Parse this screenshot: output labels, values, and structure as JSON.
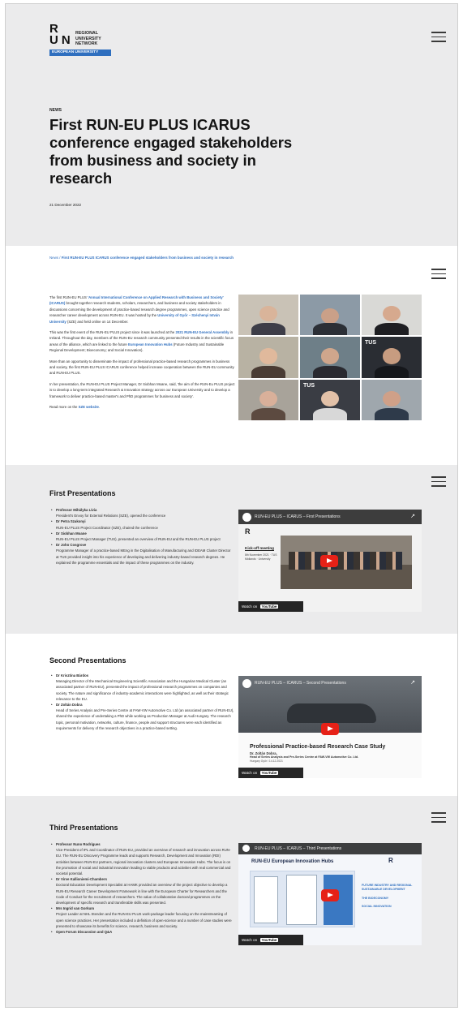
{
  "logo": {
    "letters_top": "R",
    "letters_bottom": "UN",
    "line1": "REGIONAL",
    "line2": "UNIVERSITY",
    "line3": "NETWORK",
    "bar": "EUROPEAN UNIVERSITY"
  },
  "menu_icon": "hamburger-icon",
  "article": {
    "tag": "NEWS",
    "title": "First RUN-EU PLUS ICARUS conference engaged stakeholders from business and society in research",
    "date": "21 December 2022"
  },
  "breadcrumb": {
    "home": "News",
    "sep": "/",
    "current": "First RUN-EU PLUS ICARUS conference engaged stakeholders from business and society in research"
  },
  "intro": {
    "p1_a": "The first RUN-EU PLUS ",
    "p1_link1": "'Annual International Conference on Applied Research with Business and Society' (ICARUS)",
    "p1_b": " brought together research students, scholars, researchers, and business and society stakeholders in discussions concerning the development of practice-based research degree programmes, open science practice and researcher career development across RUN-EU. It was hosted by the ",
    "p1_link2": "University of Győr – Széchenyi István University",
    "p1_c": " (SZE) and held online on 14 December.",
    "p2_a": "This was the first event of the RUN-EU PLUS project since it was launched at the ",
    "p2_link1": "2021 RUN-EU General Assembly",
    "p2_b": " in Ireland. Throughout the day, members of the RUN-EU research community presented their results in the scientific focus areas of the alliance, which are linked to the future ",
    "p2_link2": "European Innovation Hubs",
    "p2_c": " (Future Industry and Sustainable Regional Development; Bioeconomy; and Social Innovation).",
    "p3": "More than an opportunity to disseminate the impact of professional practice-based research programmes in business and society, the first RUN-EU PLUS ICARUS conference helped increase cooperation between the RUN-EU community and RUN-EU PLUS.",
    "p4": "In her presentation, the RUN-EU PLUS Project Manager, Dr Siobhan Moane, said, 'the aim of the RUN-Eu PLUS project is to develop a long-term integrated Research & Innovation strategy across our European University and to develop a framework to deliver practice-based master's and PhD programmes for business and society'.",
    "p5_a": "Read more on the ",
    "p5_link": "SZE website",
    "p5_b": ".",
    "tus_label": "TUS"
  },
  "first": {
    "title": "First Presentations",
    "items": [
      {
        "name": "Professor Mihályka Lívia",
        "desc": "President's Envoy for External Relations (SZE), opened the conference"
      },
      {
        "name": "Dr Petra Szakonyi",
        "desc": "RUN-EU PLUS Project Coordinator (SZE), chaired the conference"
      },
      {
        "name": "Dr Siobhan Moane",
        "desc": "RUN-EU PLUS Project Manager (TUS), presented an overview of RUN-EU and the RUN-EU PLUS project"
      },
      {
        "name": "Dr John Cosgrove",
        "desc": "Programme Manager of a practice-based MEng in the Digitalisation of Manufacturing and IDEAM Cluster Director at TUS provided insight into his experience of developing and delivering industry-based research degrees. He explained the programme essentials and the impact of these programmes on the industry."
      }
    ],
    "video": {
      "title": "RUN-EU PLUS – ICARUS – First Presentations",
      "kickoff": "Kick-off meeting",
      "kick_sub": "8th November 2021 · TUS Midlands · University",
      "watch_on": "Watch on",
      "youtube": "YouTube"
    }
  },
  "second": {
    "title": "Second Presentations",
    "items": [
      {
        "name": "Dr Krisztina Bárdos",
        "desc": "Managing Director of the Mechanical Engineering Scientific Association and the Hungarian Medical Cluster (an associated partner of RUN-EU), presented the impact of professional research programmes on companies and society. The nature and significance of industry-academic interactions were highlighted, as well as their strategic relevance to the EU."
      },
      {
        "name": "Dr Zoltán Dobra",
        "desc": "Head of Series Analysis and Pre-Series Centre at FAW-VW Automotive Co. Ltd (an associated partner of RUN-EU), shared the experience of undertaking a PhD while working as Production Manager at Audi Hungary. The research topic, personal motivation, networks, culture, finance, people and support structures were each identified as requirements for delivery of the research objectives in a practice-based setting."
      }
    ],
    "video": {
      "title": "RUN-EU PLUS – ICARUS – Second Presentations",
      "case_title": "Professional Practice-based Research Case Study",
      "case_name": "Dr. Zoltán Dobra,",
      "case_role": "Head of Series Analysis and Pre-Series Centre at FAW-VW Automotive Co. Ltd.",
      "case_date": "Hungary Győr / 14.12.2021",
      "watch_on": "Watch on",
      "youtube": "YouTube"
    }
  },
  "third": {
    "title": "Third Presentations",
    "items": [
      {
        "name": "Professor Nuno Rodrigues",
        "desc": "Vice-President of IPL and Coordinator of RUN-EU, provided an overview of research and innovation across RUN-EU. The RUN-EU Discovery Programme leads and supports Research, Development and Innovation (RDI) activities between RUN-EU partners, regional innovation clusters and European Innovation Hubs. The focus is on the promotion of social and industrial innovation leading to viable products and activities with real commercial and societal potential."
      },
      {
        "name": "Dr Virve Kallioniemi-Chambers",
        "desc": "Doctoral Education Development Specialist at HAMK provided an overview of the project objective to develop a RUN-EU Research Career Development Framework in line with the European Charter for Researchers and the Code of Conduct for the recruitment of researchers. The value of collaborative doctoral programmes on the development of specific research and transferable skills was presented."
      },
      {
        "name": "Mrs Ingrid van Gorkum",
        "desc": "Project Leader at NHL Stenden and the RUN-EU PLUS work-package leader focusing on the mainstreaming of open science practices. Her presentation included a definition of open-science and a number of case studies were presented to showcase its benefits for science, research, business and society."
      },
      {
        "name": "Open Forum Discussion and Q&A",
        "desc": ""
      }
    ],
    "video": {
      "title": "RUN-EU PLUS – ICARUS – Third Presentations",
      "slide_title": "RUN-EU European Innovation Hubs",
      "hub1": "FUTURE INDUSTRY AND REGIONAL SUSTAINABLE DEVELOPMENT",
      "hub2": "THE BIOECONOMY",
      "hub3": "SOCIAL INNOVATION",
      "watch_on": "Watch on",
      "youtube": "YouTube"
    }
  }
}
